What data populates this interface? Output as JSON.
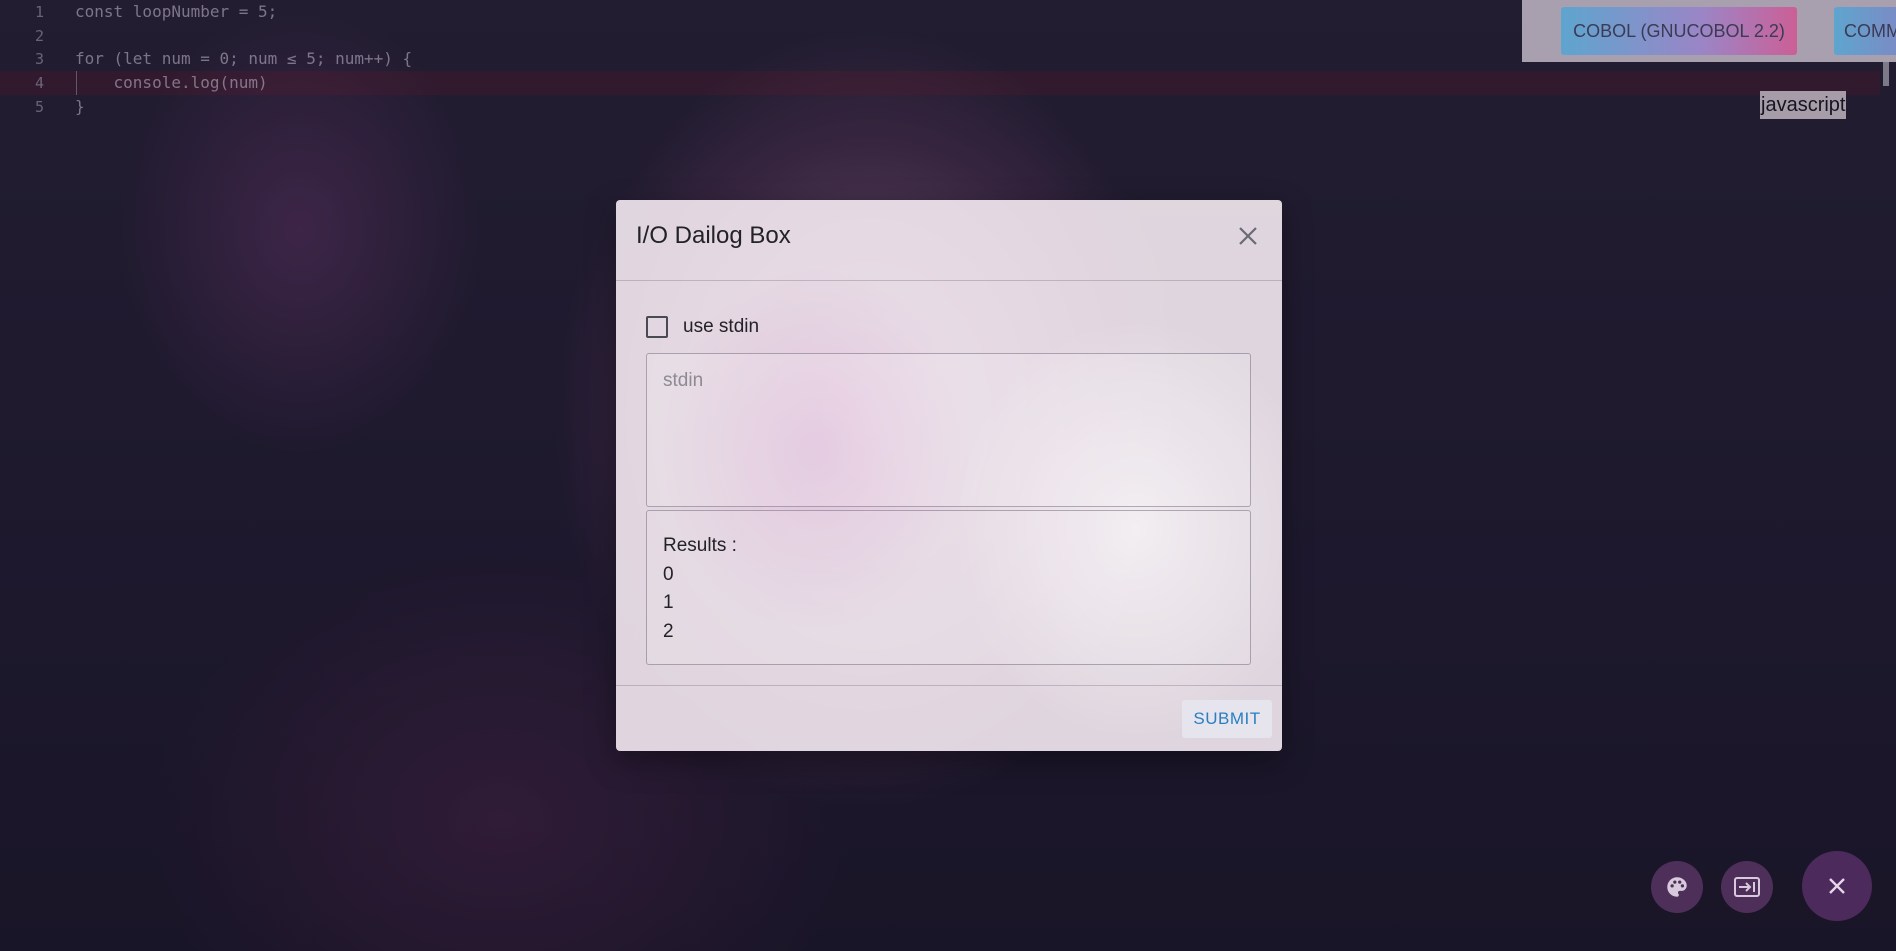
{
  "editor": {
    "lines": [
      {
        "no": "1",
        "text": "const loopNumber = 5;"
      },
      {
        "no": "2",
        "text": ""
      },
      {
        "no": "3",
        "text": "for (let num = 0; num ≤ 5; num++) {"
      },
      {
        "no": "4",
        "text": "    console.log(num)"
      },
      {
        "no": "5",
        "text": "}"
      }
    ],
    "language_label": "javascript"
  },
  "language_bar": {
    "cobol_label": "COBOL (GNUCOBOL 2.2)",
    "comm_label": "COMM"
  },
  "dialog": {
    "title": "I/O Dailog Box",
    "checkbox_label": "use stdin",
    "stdin_placeholder": "stdin",
    "results_header": "Results :",
    "results": [
      "0",
      "1",
      "2"
    ],
    "submit_label": "SUBMIT"
  },
  "fabs": {
    "icons": [
      "palette-icon",
      "input-icon",
      "close-icon"
    ]
  },
  "colors": {
    "submit": "#2a7fc0",
    "fab_main": "#4c2a5c"
  }
}
